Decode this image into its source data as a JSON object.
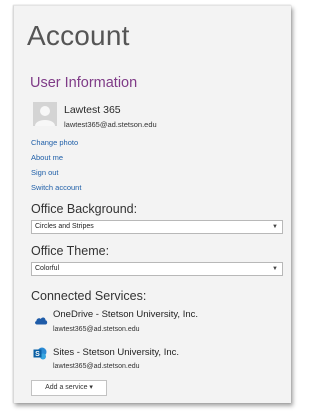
{
  "title": "Account",
  "user_information": {
    "heading": "User Information",
    "name": "Lawtest 365",
    "email": "lawtest365@ad.stetson.edu",
    "links": {
      "change_photo": "Change photo",
      "about_me": "About me",
      "sign_out": "Sign out",
      "switch_account": "Switch account"
    }
  },
  "office_background": {
    "heading": "Office Background:",
    "selected": "Circles and Stripes"
  },
  "office_theme": {
    "heading": "Office Theme:",
    "selected": "Colorful"
  },
  "connected_services": {
    "heading": "Connected Services:",
    "services": [
      {
        "name": "OneDrive - Stetson University, Inc.",
        "email": "lawtest365@ad.stetson.edu",
        "icon": "cloud-icon"
      },
      {
        "name": "Sites - Stetson University, Inc.",
        "email": "lawtest365@ad.stetson.edu",
        "icon": "sharepoint-icon"
      }
    ],
    "add_service_label": "Add a service ▾"
  },
  "colors": {
    "accent_purple": "#7f3b87",
    "link_blue": "#1f5fa8",
    "onedrive_blue": "#1e5ba8",
    "sharepoint_blue": "#0a72b8"
  }
}
